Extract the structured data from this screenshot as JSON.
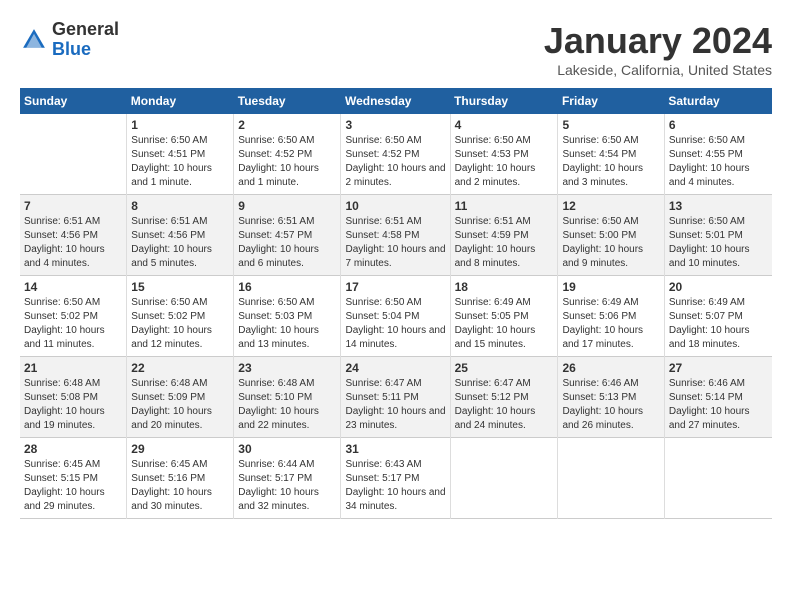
{
  "header": {
    "logo_general": "General",
    "logo_blue": "Blue",
    "month": "January 2024",
    "location": "Lakeside, California, United States"
  },
  "days_of_week": [
    "Sunday",
    "Monday",
    "Tuesday",
    "Wednesday",
    "Thursday",
    "Friday",
    "Saturday"
  ],
  "weeks": [
    [
      {
        "num": "",
        "info": ""
      },
      {
        "num": "1",
        "info": "Sunrise: 6:50 AM\nSunset: 4:51 PM\nDaylight: 10 hours\nand 1 minute."
      },
      {
        "num": "2",
        "info": "Sunrise: 6:50 AM\nSunset: 4:52 PM\nDaylight: 10 hours\nand 1 minute."
      },
      {
        "num": "3",
        "info": "Sunrise: 6:50 AM\nSunset: 4:52 PM\nDaylight: 10 hours\nand 2 minutes."
      },
      {
        "num": "4",
        "info": "Sunrise: 6:50 AM\nSunset: 4:53 PM\nDaylight: 10 hours\nand 2 minutes."
      },
      {
        "num": "5",
        "info": "Sunrise: 6:50 AM\nSunset: 4:54 PM\nDaylight: 10 hours\nand 3 minutes."
      },
      {
        "num": "6",
        "info": "Sunrise: 6:50 AM\nSunset: 4:55 PM\nDaylight: 10 hours\nand 4 minutes."
      }
    ],
    [
      {
        "num": "7",
        "info": "Sunrise: 6:51 AM\nSunset: 4:56 PM\nDaylight: 10 hours\nand 4 minutes."
      },
      {
        "num": "8",
        "info": "Sunrise: 6:51 AM\nSunset: 4:56 PM\nDaylight: 10 hours\nand 5 minutes."
      },
      {
        "num": "9",
        "info": "Sunrise: 6:51 AM\nSunset: 4:57 PM\nDaylight: 10 hours\nand 6 minutes."
      },
      {
        "num": "10",
        "info": "Sunrise: 6:51 AM\nSunset: 4:58 PM\nDaylight: 10 hours\nand 7 minutes."
      },
      {
        "num": "11",
        "info": "Sunrise: 6:51 AM\nSunset: 4:59 PM\nDaylight: 10 hours\nand 8 minutes."
      },
      {
        "num": "12",
        "info": "Sunrise: 6:50 AM\nSunset: 5:00 PM\nDaylight: 10 hours\nand 9 minutes."
      },
      {
        "num": "13",
        "info": "Sunrise: 6:50 AM\nSunset: 5:01 PM\nDaylight: 10 hours\nand 10 minutes."
      }
    ],
    [
      {
        "num": "14",
        "info": "Sunrise: 6:50 AM\nSunset: 5:02 PM\nDaylight: 10 hours\nand 11 minutes."
      },
      {
        "num": "15",
        "info": "Sunrise: 6:50 AM\nSunset: 5:02 PM\nDaylight: 10 hours\nand 12 minutes."
      },
      {
        "num": "16",
        "info": "Sunrise: 6:50 AM\nSunset: 5:03 PM\nDaylight: 10 hours\nand 13 minutes."
      },
      {
        "num": "17",
        "info": "Sunrise: 6:50 AM\nSunset: 5:04 PM\nDaylight: 10 hours\nand 14 minutes."
      },
      {
        "num": "18",
        "info": "Sunrise: 6:49 AM\nSunset: 5:05 PM\nDaylight: 10 hours\nand 15 minutes."
      },
      {
        "num": "19",
        "info": "Sunrise: 6:49 AM\nSunset: 5:06 PM\nDaylight: 10 hours\nand 17 minutes."
      },
      {
        "num": "20",
        "info": "Sunrise: 6:49 AM\nSunset: 5:07 PM\nDaylight: 10 hours\nand 18 minutes."
      }
    ],
    [
      {
        "num": "21",
        "info": "Sunrise: 6:48 AM\nSunset: 5:08 PM\nDaylight: 10 hours\nand 19 minutes."
      },
      {
        "num": "22",
        "info": "Sunrise: 6:48 AM\nSunset: 5:09 PM\nDaylight: 10 hours\nand 20 minutes."
      },
      {
        "num": "23",
        "info": "Sunrise: 6:48 AM\nSunset: 5:10 PM\nDaylight: 10 hours\nand 22 minutes."
      },
      {
        "num": "24",
        "info": "Sunrise: 6:47 AM\nSunset: 5:11 PM\nDaylight: 10 hours\nand 23 minutes."
      },
      {
        "num": "25",
        "info": "Sunrise: 6:47 AM\nSunset: 5:12 PM\nDaylight: 10 hours\nand 24 minutes."
      },
      {
        "num": "26",
        "info": "Sunrise: 6:46 AM\nSunset: 5:13 PM\nDaylight: 10 hours\nand 26 minutes."
      },
      {
        "num": "27",
        "info": "Sunrise: 6:46 AM\nSunset: 5:14 PM\nDaylight: 10 hours\nand 27 minutes."
      }
    ],
    [
      {
        "num": "28",
        "info": "Sunrise: 6:45 AM\nSunset: 5:15 PM\nDaylight: 10 hours\nand 29 minutes."
      },
      {
        "num": "29",
        "info": "Sunrise: 6:45 AM\nSunset: 5:16 PM\nDaylight: 10 hours\nand 30 minutes."
      },
      {
        "num": "30",
        "info": "Sunrise: 6:44 AM\nSunset: 5:17 PM\nDaylight: 10 hours\nand 32 minutes."
      },
      {
        "num": "31",
        "info": "Sunrise: 6:43 AM\nSunset: 5:17 PM\nDaylight: 10 hours\nand 34 minutes."
      },
      {
        "num": "",
        "info": ""
      },
      {
        "num": "",
        "info": ""
      },
      {
        "num": "",
        "info": ""
      }
    ]
  ]
}
